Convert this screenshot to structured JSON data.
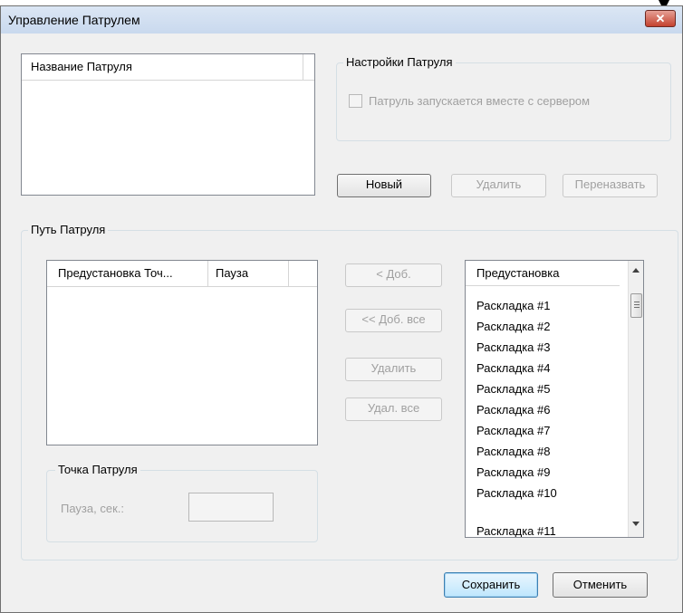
{
  "window": {
    "title": "Управление Патрулем",
    "close_glyph": "✕"
  },
  "patrol_list": {
    "header": "Название Патруля"
  },
  "patrol_settings": {
    "group_label": "Настройки Патруля",
    "autostart_label": "Патруль запускается вместе с сервером",
    "autostart_checked": false
  },
  "patrol_buttons": {
    "new": "Новый",
    "delete": "Удалить",
    "rename": "Переназвать"
  },
  "patrol_path": {
    "group_label": "Путь Патруля",
    "columns": [
      "Предустановка Точ...",
      "Пауза"
    ],
    "buttons": {
      "add": "< Доб.",
      "add_all": "<< Доб. все",
      "remove": "Удалить",
      "remove_all": "Удал. все"
    },
    "presets_header": "Предустановка",
    "presets": [
      "Раскладка #1",
      "Раскладка #2",
      "Раскладка #3",
      "Раскладка #4",
      "Раскладка #5",
      "Раскладка #6",
      "Раскладка #7",
      "Раскладка #8",
      "Раскладка #9",
      "Раскладка #10",
      "Раскладка #11"
    ]
  },
  "patrol_point": {
    "group_label": "Точка Патруля",
    "pause_label": "Пауза, сек.:",
    "pause_value": ""
  },
  "footer": {
    "save": "Сохранить",
    "cancel": "Отменить"
  }
}
